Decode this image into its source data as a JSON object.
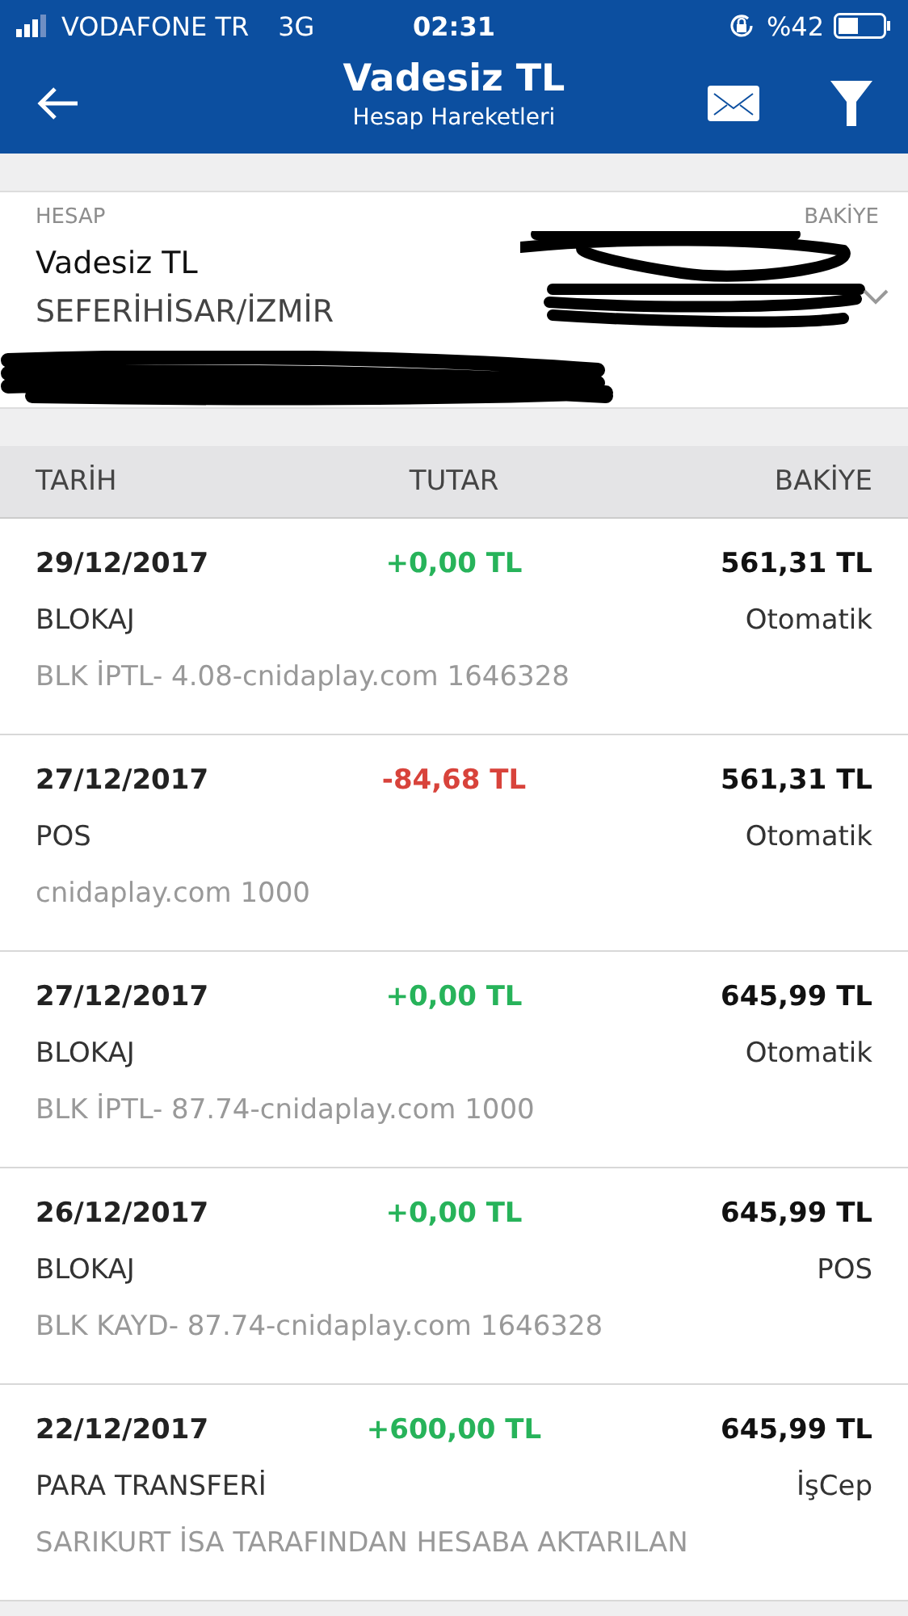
{
  "status_bar": {
    "carrier": "VODAFONE TR",
    "network": "3G",
    "time": "02:31",
    "battery": "%42"
  },
  "header": {
    "title": "Vadesiz TL",
    "subtitle": "Hesap Hareketleri"
  },
  "account": {
    "label": "HESAP",
    "balance_label": "BAKİYE",
    "name": "Vadesiz TL",
    "branch": "SEFERİHİSAR/İZMİR"
  },
  "table": {
    "columns": [
      "TARİH",
      "TUTAR",
      "BAKİYE"
    ],
    "rows": [
      {
        "date": "29/12/2017",
        "amount": "+0,00 TL",
        "kind": "credit",
        "balance": "561,31 TL",
        "type": "BLOKAJ",
        "channel": "Otomatik",
        "description": "BLK İPTL- 4.08-cnidaplay.com 1646328"
      },
      {
        "date": "27/12/2017",
        "amount": "-84,68 TL",
        "kind": "debit",
        "balance": "561,31 TL",
        "type": "POS",
        "channel": "Otomatik",
        "description": "cnidaplay.com 1000"
      },
      {
        "date": "27/12/2017",
        "amount": "+0,00 TL",
        "kind": "credit",
        "balance": "645,99 TL",
        "type": "BLOKAJ",
        "channel": "Otomatik",
        "description": "BLK İPTL- 87.74-cnidaplay.com 1000"
      },
      {
        "date": "26/12/2017",
        "amount": "+0,00 TL",
        "kind": "credit",
        "balance": "645,99 TL",
        "type": "BLOKAJ",
        "channel": "POS",
        "description": "BLK KAYD- 87.74-cnidaplay.com 1646328"
      },
      {
        "date": "22/12/2017",
        "amount": "+600,00 TL",
        "kind": "credit",
        "balance": "645,99 TL",
        "type": "PARA TRANSFERİ",
        "channel": "İşCep",
        "description": "SARIKURT İSA TARAFINDAN HESABA AKTARILAN"
      }
    ]
  }
}
